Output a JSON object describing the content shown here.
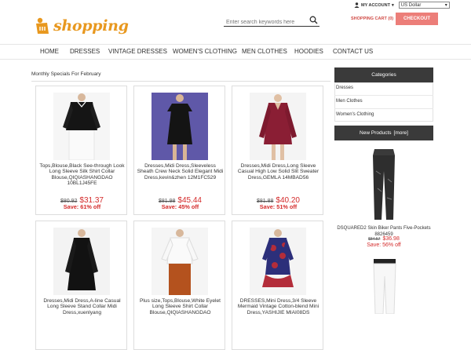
{
  "brand": {
    "name": "shopping"
  },
  "search": {
    "placeholder": "Enter search keywords here"
  },
  "topbar": {
    "account_label": "MY ACCOUNT",
    "currency": "US Dollar"
  },
  "cart": {
    "label": "SHOPPING CART (0)",
    "checkout": "CHECKOUT"
  },
  "nav": [
    "HOME",
    "DRESSES",
    "VINTAGE DRESSES",
    "WOMEN'S CLOTHING",
    "MEN CLOTHES",
    "HOODIES",
    "CONTACT US"
  ],
  "section": {
    "title": "Monthly Specials For February"
  },
  "products": [
    {
      "name": "Tops,Blouse,Black See-through Look Long Sleeve Silk Shirt Collar Blouse,QIQIASHANGDAO 10BL1J45FE",
      "old_price": "$80.92",
      "new_price": "$31.37",
      "save": "Save: 61% off"
    },
    {
      "name": "Dresses,Midi Dress,Sleeveless Sheath Crew Neck Solid Elegant Midi Dress,kevin&zhen 12M1FC529",
      "old_price": "$81.98",
      "new_price": "$45.44",
      "save": "Save: 45% off"
    },
    {
      "name": "Dresses,Midi Dress,Long Sleeve Casual High Low Solid Slit Sweater Dress,GEMLA 14MBAD56",
      "old_price": "$81.88",
      "new_price": "$40.20",
      "save": "Save: 51% off"
    },
    {
      "name": "Dresses,Midi Dress,A-line Casual Long Sleeve Stand Collar Midi Dress,xuenlyang",
      "old_price": "",
      "new_price": "",
      "save": ""
    },
    {
      "name": "Plus size,Tops,Blouse,White Eyelet Long Sleeve Shirt Collar Blouse,QIQIASHANGDAO",
      "old_price": "",
      "new_price": "",
      "save": ""
    },
    {
      "name": "DRESSES,Mini Dress,3/4 Sleeve Mermaid Vintage Cotton-blend Mini Dress,YASHIJIE MIAI08DS",
      "old_price": "",
      "new_price": "",
      "save": ""
    }
  ],
  "sidebar": {
    "categories_title": "Categories",
    "categories": [
      "Dresses",
      "Men Clothes",
      "Women's Clothing"
    ],
    "new_products_title": "New Products",
    "more_label": "[more]",
    "new_product": {
      "name": "DSQUARED2 Skin Biker Pants Five-Pockets 8826459",
      "old_price": "$84.57",
      "new_price": "$36.98",
      "save": "Save: 56% off"
    }
  },
  "colors": {
    "brand": "#e8981f",
    "accent": "#d42b2b",
    "checkout": "#ec7e79",
    "sidebar_head": "#3a3a3a"
  }
}
